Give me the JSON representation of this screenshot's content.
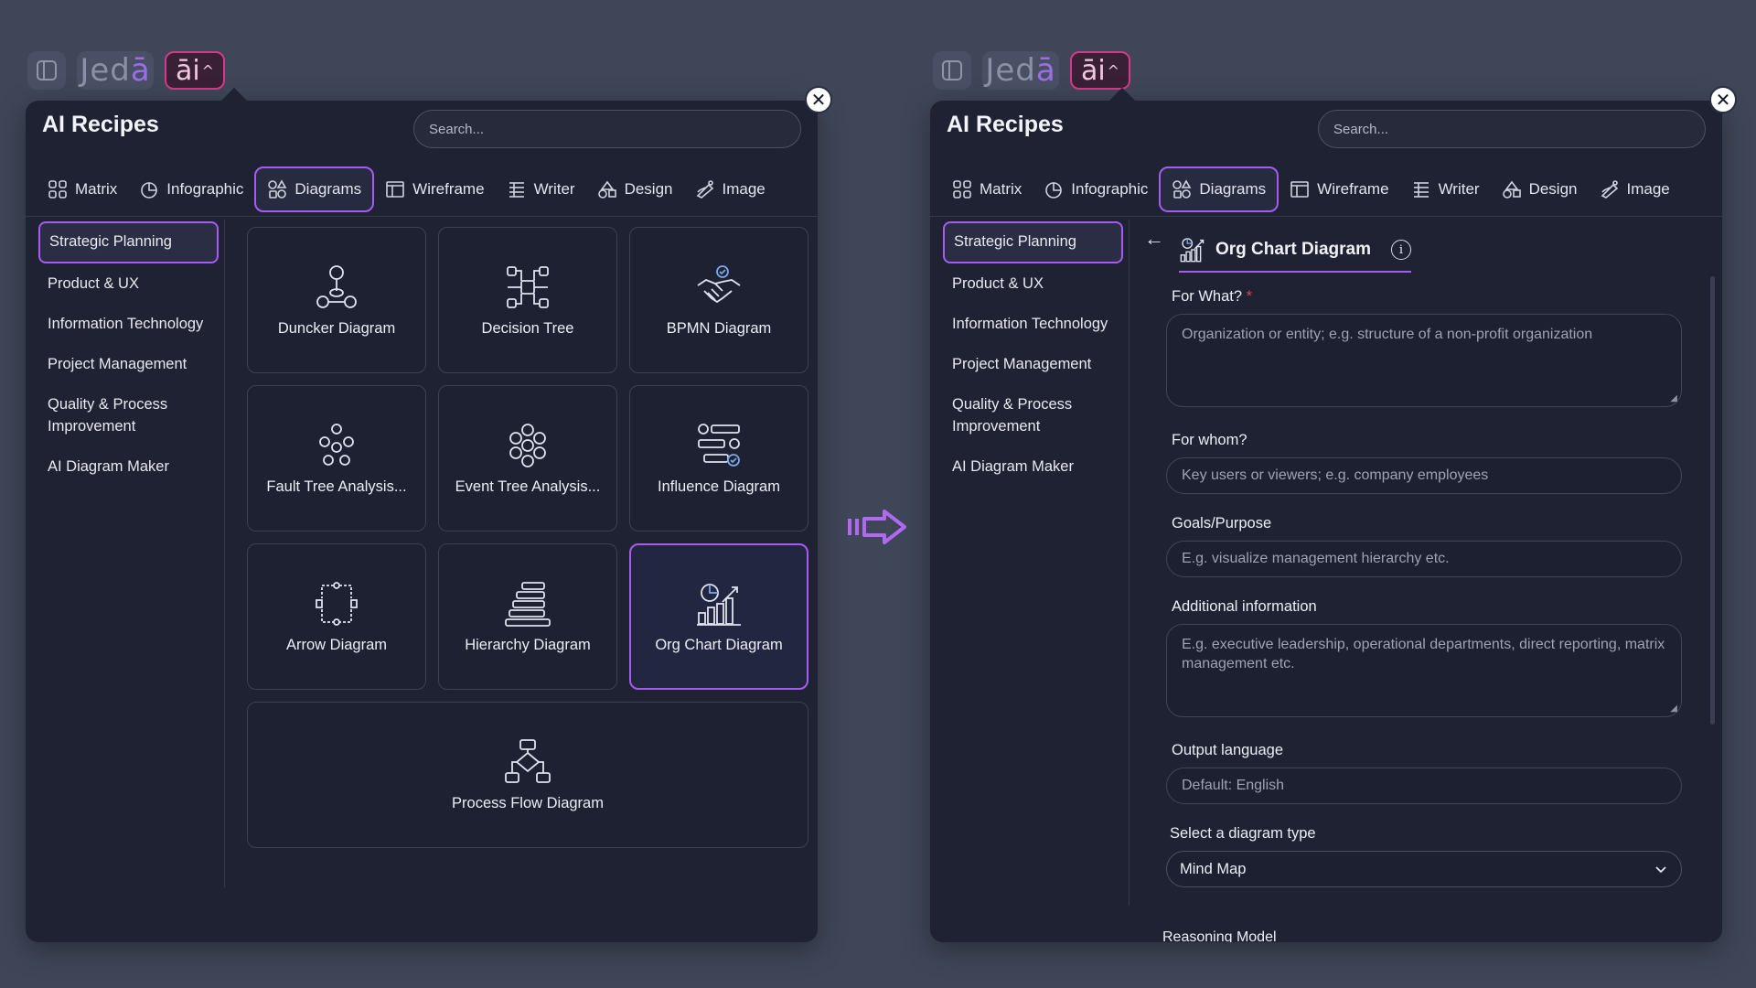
{
  "toolbar": {
    "brand": "Jed",
    "brand_accent": "ā",
    "ai_label": "āi",
    "ai_caret": "^"
  },
  "panel": {
    "title": "AI Recipes",
    "search_placeholder": "Search...",
    "close": "✕",
    "tabs": [
      {
        "label": "Matrix",
        "icon": "grid-icon"
      },
      {
        "label": "Infographic",
        "icon": "pie-icon"
      },
      {
        "label": "Diagrams",
        "icon": "shapes-icon"
      },
      {
        "label": "Wireframe",
        "icon": "wireframe-icon"
      },
      {
        "label": "Writer",
        "icon": "writer-icon"
      },
      {
        "label": "Design",
        "icon": "design-icon"
      },
      {
        "label": "Image",
        "icon": "image-icon"
      }
    ],
    "active_tab": "Diagrams",
    "sidebar": [
      {
        "label": "Strategic Planning"
      },
      {
        "label": "Product & UX"
      },
      {
        "label": "Information Technology"
      },
      {
        "label": "Project Management"
      },
      {
        "label": "Quality & Process Improvement"
      },
      {
        "label": "AI Diagram Maker"
      }
    ]
  },
  "diagrams": [
    {
      "label": "Duncker Diagram",
      "icon": "duncker-icon"
    },
    {
      "label": "Decision Tree",
      "icon": "decision-tree-icon"
    },
    {
      "label": "BPMN Diagram",
      "icon": "handshake-icon"
    },
    {
      "label": "Fault Tree Analysis...",
      "icon": "fault-tree-icon"
    },
    {
      "label": "Event Tree Analysis...",
      "icon": "event-tree-icon"
    },
    {
      "label": "Influence Diagram",
      "icon": "influence-icon"
    },
    {
      "label": "Arrow Diagram",
      "icon": "arrow-diagram-icon"
    },
    {
      "label": "Hierarchy Diagram",
      "icon": "hierarchy-icon"
    },
    {
      "label": "Org Chart Diagram",
      "icon": "org-chart-icon"
    },
    {
      "label": "Process Flow Diagram",
      "icon": "process-flow-icon"
    }
  ],
  "form": {
    "back": "←",
    "title": "Org Chart Diagram",
    "info": "i",
    "for_what_label": "For What?",
    "required_mark": "*",
    "for_what_placeholder": "Organization or entity; e.g. structure of a non-profit organization",
    "for_whom_label": "For whom?",
    "for_whom_placeholder": "Key users or viewers; e.g. company employees",
    "goals_label": "Goals/Purpose",
    "goals_placeholder": "E.g. visualize management hierarchy etc.",
    "additional_label": "Additional information",
    "additional_placeholder": "E.g. executive leadership, operational departments, direct reporting, matrix management etc.",
    "output_language_label": "Output language",
    "output_language_placeholder": "Default: English",
    "diagram_type_label": "Select a diagram type",
    "diagram_type_value": "Mind Map",
    "next_label_cut": "Reasoning Model"
  },
  "colors": {
    "accent": "#a65cf0",
    "panel_bg": "#1e2233",
    "page_bg": "#3f4658",
    "ai_border": "#d33b8a"
  }
}
